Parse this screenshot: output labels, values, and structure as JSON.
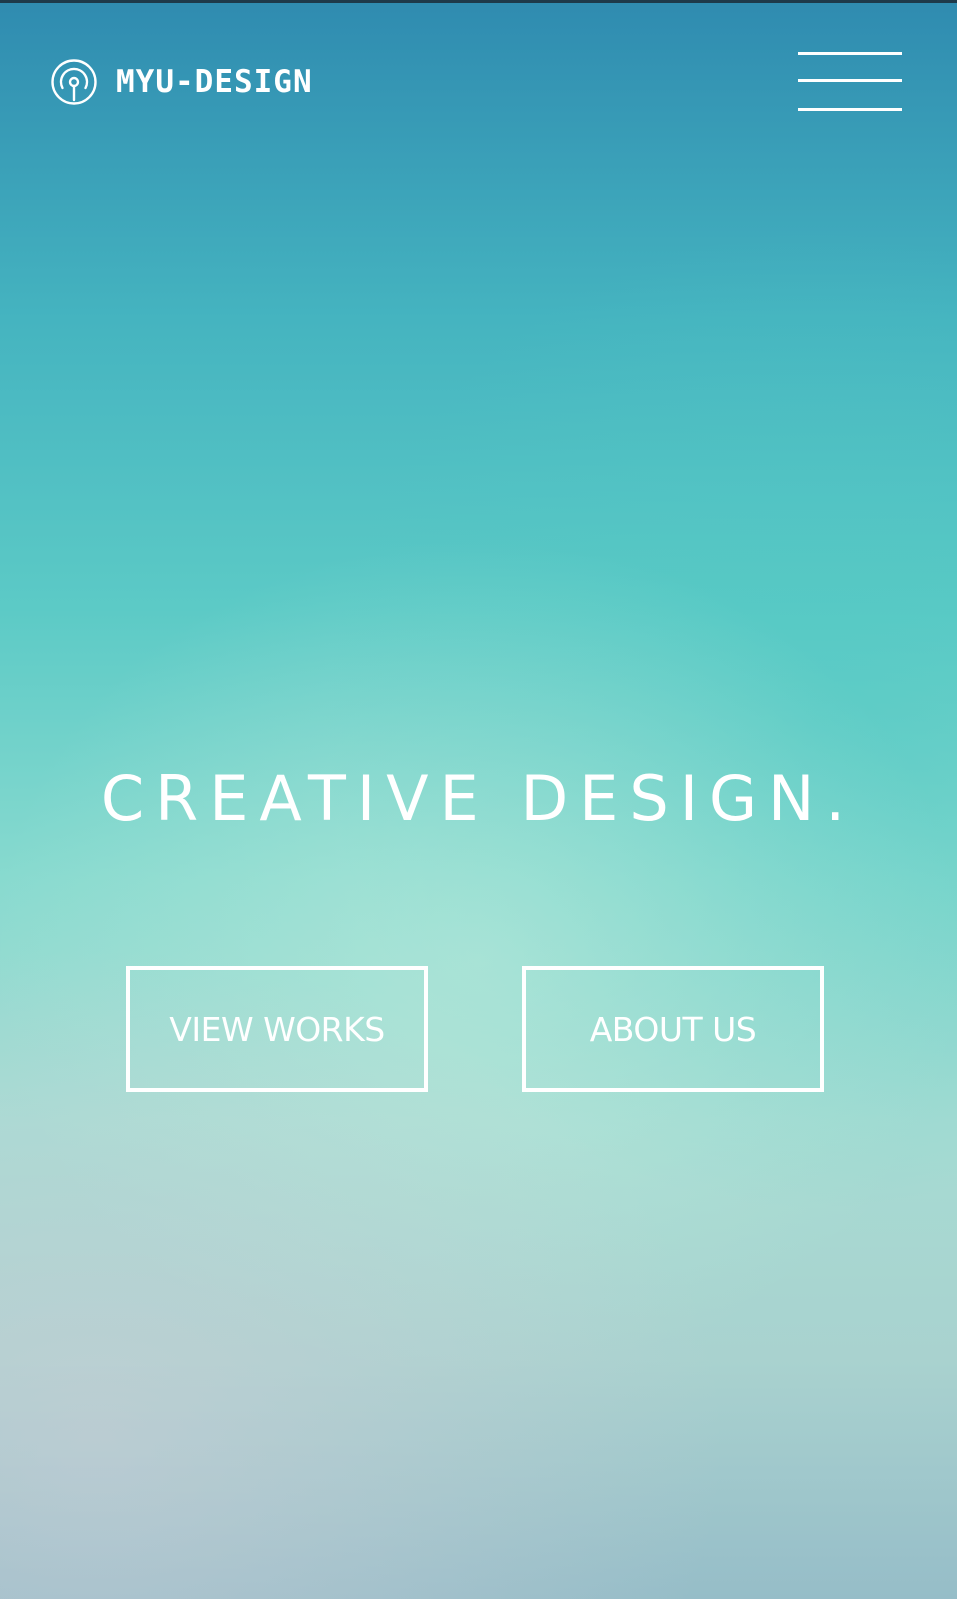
{
  "brand": {
    "name": "MYU-DESIGN",
    "logo_icon": "broadcast-icon"
  },
  "header": {
    "menu_icon": "hamburger-icon"
  },
  "hero": {
    "title": "CREATIVE DESIGN.",
    "buttons": [
      {
        "label": "VIEW WORKS"
      },
      {
        "label": "ABOUT US"
      }
    ]
  },
  "colors": {
    "top": "#2f8bb0",
    "middle": "#88dacf",
    "bottom": "#96bdc8",
    "foreground": "#ffffff"
  }
}
